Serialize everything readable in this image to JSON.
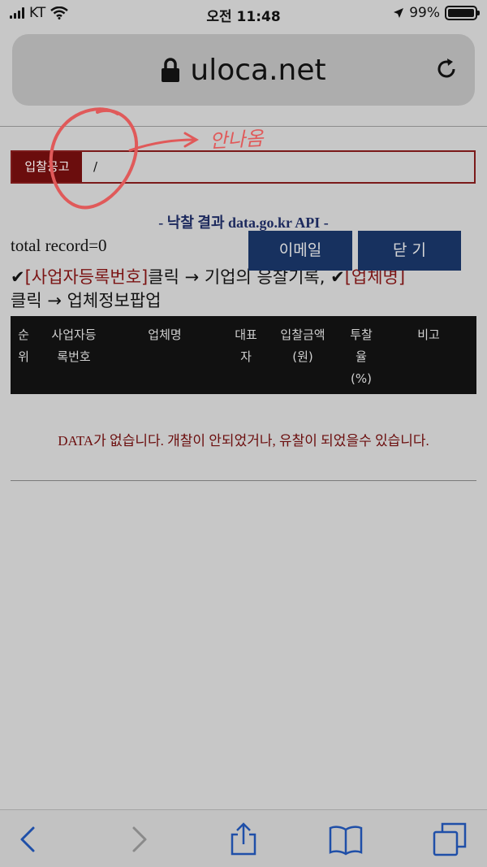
{
  "status_bar": {
    "carrier": "KT",
    "time": "오전 11:48",
    "battery": "99%",
    "battery_level": 0.99
  },
  "browser": {
    "url": "uloca.net",
    "icons": {
      "lock": "lock-icon",
      "reload": "reload-icon"
    }
  },
  "bid_notice": {
    "label": "입찰공고",
    "value": "/"
  },
  "annotation": {
    "text": "안나옴"
  },
  "page": {
    "api_title": "- 낙찰 결과 data.go.kr API -",
    "total_record": "total record=0",
    "email_button": "이메일",
    "close_button": "닫 기",
    "instruction": {
      "check1": "✔",
      "link1": "[사업자등록번호]",
      "part1": "클릭 → 기업의 응찰기록, ",
      "check2": "✔",
      "link2": "[업체명]",
      "part2": "클릭 → 업체정보팝업"
    }
  },
  "table": {
    "headers": {
      "rank": "순\n위",
      "biz_no": "사업자등\n록번호",
      "company": "업체명",
      "ceo": "대표\n자",
      "amount": "입찰금액\n(원)",
      "rate": "투찰\n율\n(%)",
      "note": "비고"
    }
  },
  "empty_message": "DATA가 없습니다. 개찰이 안되었거나, 유찰이 되었을수 있습니다.",
  "toolbar": {
    "icons": [
      "back-icon",
      "forward-icon",
      "share-icon",
      "bookmarks-icon",
      "tabs-icon"
    ]
  },
  "colors": {
    "annotation": "#e05a5a",
    "button": "#17315f",
    "label_bg": "#6b0d0d",
    "safari_blue": "#1f4fa8"
  }
}
